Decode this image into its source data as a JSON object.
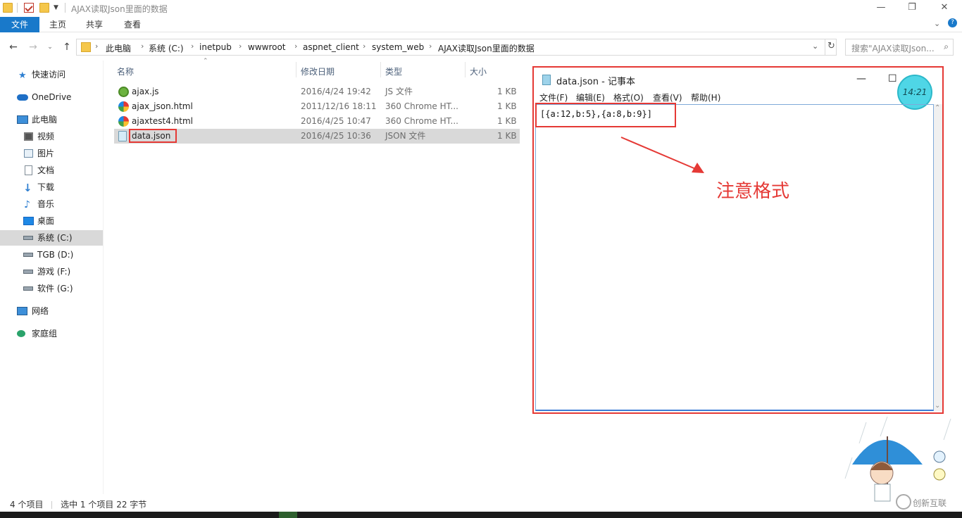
{
  "window": {
    "title": "AJAX读取Json里面的数据",
    "minimize": "—",
    "maximize": "❐",
    "close": "✕"
  },
  "ribbon": {
    "tabs": [
      "文件",
      "主页",
      "共享",
      "查看"
    ]
  },
  "address": {
    "crumbs": [
      "此电脑",
      "系统 (C:)",
      "inetpub",
      "wwwroot",
      "aspnet_client",
      "system_web",
      "AJAX读取Json里面的数据"
    ],
    "search_placeholder": "搜索\"AJAX读取Json..."
  },
  "nav": {
    "items": [
      {
        "label": "快速访问",
        "icon": "star-icon"
      },
      {
        "label": "OneDrive",
        "icon": "cloud-icon"
      },
      {
        "label": "此电脑",
        "icon": "computer-icon"
      },
      {
        "label": "视频",
        "icon": "video-icon"
      },
      {
        "label": "图片",
        "icon": "picture-icon"
      },
      {
        "label": "文档",
        "icon": "document-icon"
      },
      {
        "label": "下载",
        "icon": "download-icon"
      },
      {
        "label": "音乐",
        "icon": "music-icon"
      },
      {
        "label": "桌面",
        "icon": "desktop-icon"
      },
      {
        "label": "系统 (C:)",
        "icon": "drive-icon"
      },
      {
        "label": "TGB (D:)",
        "icon": "drive-icon"
      },
      {
        "label": "游戏 (F:)",
        "icon": "drive-icon"
      },
      {
        "label": "软件 (G:)",
        "icon": "drive-icon"
      },
      {
        "label": "网络",
        "icon": "network-icon"
      },
      {
        "label": "家庭组",
        "icon": "homegroup-icon"
      }
    ]
  },
  "filelist": {
    "columns": [
      "名称",
      "修改日期",
      "类型",
      "大小"
    ],
    "rows": [
      {
        "name": "ajax.js",
        "date": "2016/4/24 19:42",
        "type": "JS 文件",
        "size": "1 KB"
      },
      {
        "name": "ajax_json.html",
        "date": "2011/12/16 18:11",
        "type": "360 Chrome HT...",
        "size": "1 KB"
      },
      {
        "name": "ajaxtest4.html",
        "date": "2016/4/25 10:47",
        "type": "360 Chrome HT...",
        "size": "1 KB"
      },
      {
        "name": "data.json",
        "date": "2016/4/25 10:36",
        "type": "JSON 文件",
        "size": "1 KB"
      }
    ]
  },
  "notepad": {
    "title": "data.json - 记事本",
    "menu": [
      "文件(F)",
      "编辑(E)",
      "格式(O)",
      "查看(V)",
      "帮助(H)"
    ],
    "content": "[{a:12,b:5},{a:8,b:9}]",
    "annotation": "注意格式",
    "clock": "14:21"
  },
  "status": {
    "count": "4 个项目",
    "selection": "选中 1 个项目  22 字节"
  },
  "watermark": "创新互联"
}
